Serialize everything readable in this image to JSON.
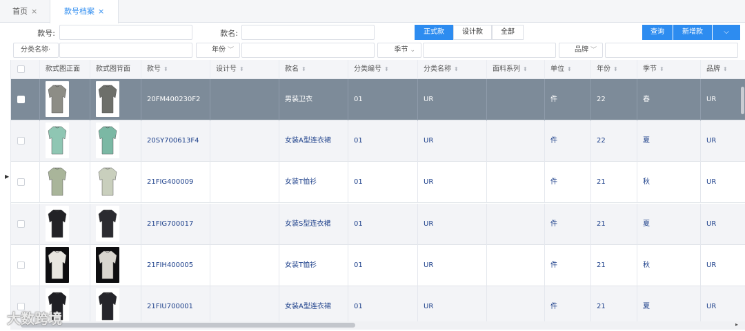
{
  "tabs": [
    {
      "label": "首页",
      "active": false
    },
    {
      "label": "款号档案",
      "active": true
    }
  ],
  "filters": {
    "style_no_label": "款号:",
    "style_name_label": "款名:",
    "category_label": "分类名称·",
    "year_label": "年份",
    "season_label": "季节",
    "brand_label": "品牌"
  },
  "segments": [
    "正式款",
    "设计款",
    "全部"
  ],
  "buttons": {
    "query": "查询",
    "add": "新增款",
    "more": "⌵"
  },
  "columns": [
    "款式图正面",
    "款式图背面",
    "款号",
    "设计号",
    "款名",
    "分类编号",
    "分类名称",
    "面料系列",
    "单位",
    "年份",
    "季节",
    "品牌"
  ],
  "rows": [
    {
      "style_no": "20FM400230F2",
      "design_no": "",
      "name": "男装卫衣",
      "cat_no": "01",
      "cat_name": "UR",
      "fabric": "",
      "unit": "件",
      "year": "22",
      "season": "春",
      "brand": "UR",
      "selected": true
    },
    {
      "style_no": "20SY700613F4",
      "design_no": "",
      "name": "女装A型连衣裙",
      "cat_no": "01",
      "cat_name": "UR",
      "fabric": "",
      "unit": "件",
      "year": "22",
      "season": "夏",
      "brand": "UR",
      "selected": false
    },
    {
      "style_no": "21FIG400009",
      "design_no": "",
      "name": "女装T恤衫",
      "cat_no": "01",
      "cat_name": "UR",
      "fabric": "",
      "unit": "件",
      "year": "21",
      "season": "秋",
      "brand": "UR",
      "selected": false
    },
    {
      "style_no": "21FIG700017",
      "design_no": "",
      "name": "女装S型连衣裙",
      "cat_no": "01",
      "cat_name": "UR",
      "fabric": "",
      "unit": "件",
      "year": "21",
      "season": "夏",
      "brand": "UR",
      "selected": false
    },
    {
      "style_no": "21FIH400005",
      "design_no": "",
      "name": "女装T恤衫",
      "cat_no": "01",
      "cat_name": "UR",
      "fabric": "",
      "unit": "件",
      "year": "21",
      "season": "秋",
      "brand": "UR",
      "selected": false
    },
    {
      "style_no": "21FIU700001",
      "design_no": "",
      "name": "女装A型连衣裙",
      "cat_no": "01",
      "cat_name": "UR",
      "fabric": "",
      "unit": "件",
      "year": "21",
      "season": "夏",
      "brand": "UR",
      "selected": false
    }
  ],
  "watermark": "大数跨境",
  "colors": {
    "accent": "#2d8cf0",
    "selected_row": "#7d8b99",
    "cell_text": "#1c3f8a"
  }
}
